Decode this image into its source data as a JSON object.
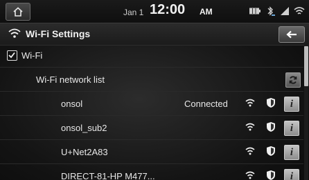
{
  "status_bar": {
    "date": "Jan 1",
    "time": "12:00",
    "ampm": "AM",
    "icons": [
      "battery-icon",
      "bluetooth-icon",
      "signal-icon",
      "wifi-icon"
    ]
  },
  "header": {
    "title": "Wi-Fi Settings",
    "back_icon": "back-arrow-icon"
  },
  "wifi_toggle": {
    "label": "Wi-Fi",
    "checked": true
  },
  "network_list": {
    "label": "Wi-Fi network list",
    "refresh_icon": "refresh-icon",
    "networks": [
      {
        "name": "onsol",
        "status": "Connected"
      },
      {
        "name": "onsol_sub2",
        "status": ""
      },
      {
        "name": "U+Net2A83",
        "status": ""
      },
      {
        "name": "DIRECT-81-HP M477...",
        "status": ""
      }
    ],
    "info_label": "i"
  }
}
